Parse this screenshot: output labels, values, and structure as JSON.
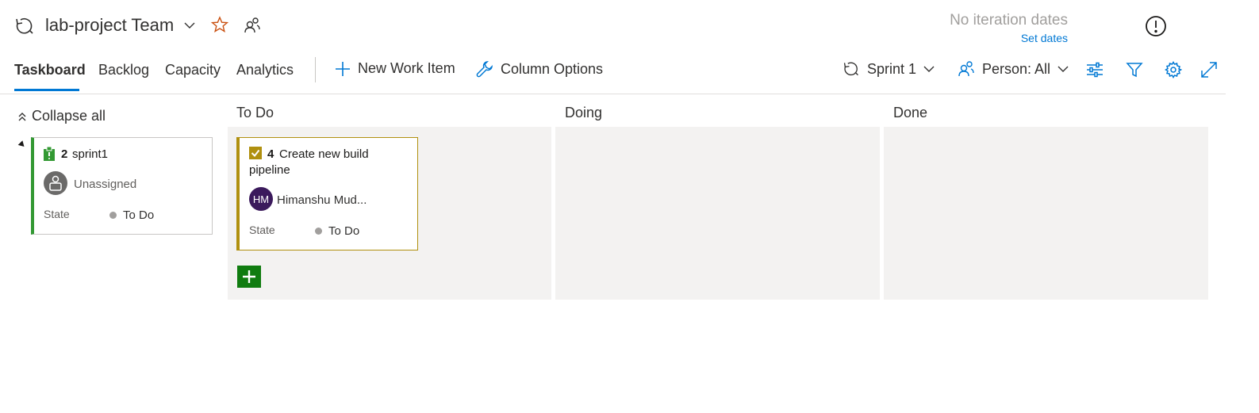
{
  "header": {
    "team_name": "lab-project Team",
    "iteration_text": "No iteration dates",
    "set_dates_label": "Set dates"
  },
  "toolbar": {
    "tabs": [
      {
        "label": "Taskboard",
        "active": true
      },
      {
        "label": "Backlog",
        "active": false
      },
      {
        "label": "Capacity",
        "active": false
      },
      {
        "label": "Analytics",
        "active": false
      }
    ],
    "new_work_item_label": "New Work Item",
    "column_options_label": "Column Options",
    "sprint_label": "Sprint 1",
    "person_label": "Person: All"
  },
  "board": {
    "collapse_all_label": "Collapse all",
    "columns": [
      "To Do",
      "Doing",
      "Done"
    ],
    "parent_card": {
      "id": "2",
      "title": "sprint1",
      "assignee": "Unassigned",
      "state_label": "State",
      "state_value": "To Do",
      "accent_color": "#339933"
    },
    "task_card": {
      "id": "4",
      "title_line1": "Create new build",
      "title_line2": "pipeline",
      "assignee_initials": "HM",
      "assignee": "Himanshu Mud...",
      "state_label": "State",
      "state_value": "To Do",
      "accent_color": "#b0900f"
    }
  },
  "colors": {
    "accent_blue": "#0078d4",
    "add_button_green": "#107c10",
    "star_orange": "#ca5010",
    "lane_background": "#f3f2f1"
  },
  "icons": [
    "sprint-icon",
    "chevron-down-icon",
    "star-icon",
    "team-members-icon",
    "info-icon",
    "plus-icon",
    "wrench-icon",
    "person-icon",
    "settings-sliders-icon",
    "filter-icon",
    "gear-icon",
    "expand-icon",
    "collapse-chevrons-icon",
    "task-check-icon",
    "backlog-item-icon"
  ]
}
